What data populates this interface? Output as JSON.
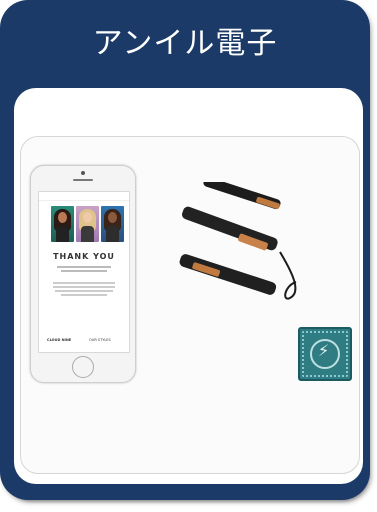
{
  "card": {
    "title": "アンイル電子"
  },
  "phone": {
    "headline": "THANK YOU",
    "bottom_left": "CLOUD NINE",
    "bottom_right": "OUR STYLES"
  },
  "icons": [
    "flat-iron-icon",
    "phone-screenshot",
    "wireless-charger-icon"
  ],
  "colors": {
    "card_bg": "#1b3a68",
    "panel_bg": "#ffffff",
    "gadget": "#2f7d82",
    "iron_plate": "#c0793f"
  }
}
